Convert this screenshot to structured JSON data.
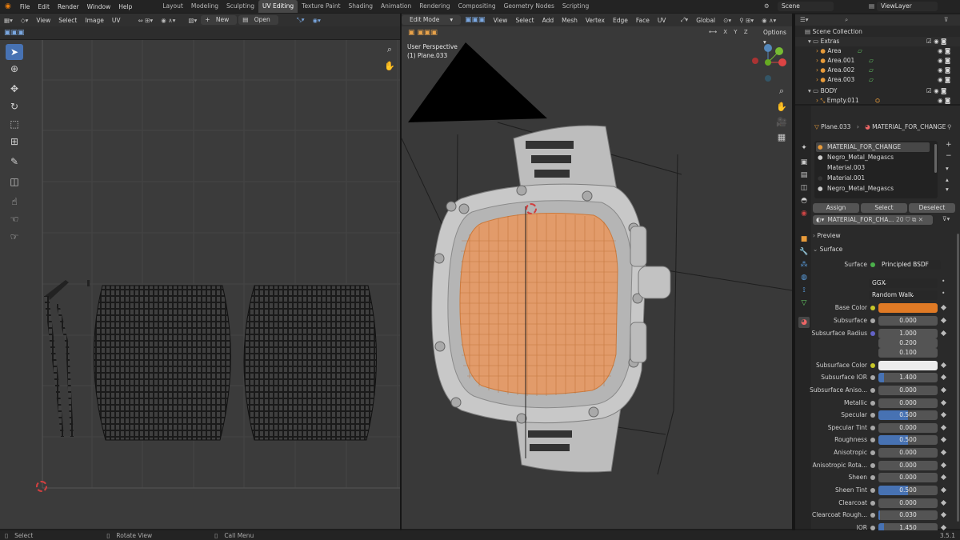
{
  "topbar": {
    "menu": [
      "File",
      "Edit",
      "Render",
      "Window",
      "Help"
    ],
    "tabs": [
      "Layout",
      "Modeling",
      "Sculpting",
      "UV Editing",
      "Texture Paint",
      "Shading",
      "Animation",
      "Rendering",
      "Compositing",
      "Geometry Nodes",
      "Scripting"
    ],
    "active_tab": "UV Editing",
    "scene": "Scene",
    "view_layer": "ViewLayer"
  },
  "uv_header": {
    "menus": [
      "View",
      "Select",
      "Image",
      "UV"
    ],
    "new_label": "New",
    "open_label": "Open"
  },
  "viewport_header": {
    "mode": "Edit Mode",
    "menus": [
      "View",
      "Select",
      "Add",
      "Mesh",
      "Vertex",
      "Edge",
      "Face",
      "UV"
    ],
    "orientation": "Global",
    "options_label": "Options",
    "axes": [
      "X",
      "Y",
      "Z"
    ]
  },
  "viewport": {
    "perspective": "User Perspective",
    "object": "(1) Plane.033"
  },
  "outliner": {
    "root": "Scene Collection",
    "rows": [
      {
        "name": "Extras",
        "level": 1
      },
      {
        "name": "Area",
        "level": 2
      },
      {
        "name": "Area.001",
        "level": 2
      },
      {
        "name": "Area.002",
        "level": 2
      },
      {
        "name": "Area.003",
        "level": 2
      },
      {
        "name": "BODY",
        "level": 1
      },
      {
        "name": "Empty.011",
        "level": 2
      }
    ]
  },
  "properties": {
    "breadcrumb_object": "Plane.033",
    "breadcrumb_material": "MATERIAL_FOR_CHANGE",
    "material_slots": [
      "MATERIAL_FOR_CHANGE",
      "Negro_Metal_Megascs",
      "Material.003",
      "Material.001",
      "Negro_Metal_Megascs"
    ],
    "active_slot": "MATERIAL_FOR_CHANGE",
    "assign_label": "Assign",
    "select_label": "Select",
    "deselect_label": "Deselect",
    "material_name": "MATERIAL_FOR_CHA...",
    "user_count": "20",
    "preview_label": "Preview",
    "surface_panel_label": "Surface",
    "surface_label": "Surface",
    "surface_shader": "Principled BSDF",
    "distribution": "GGX",
    "subsurface_method": "Random Walk",
    "base_color_label": "Base Color",
    "base_color": "#e07a25",
    "subsurface_color_label": "Subsurface Color",
    "subsurface_color": "#ececec",
    "subsurface_radius_label": "Subsurface Radius",
    "subsurface_radius": [
      "1.000",
      "0.200",
      "0.100"
    ],
    "params": [
      {
        "label": "Subsurface",
        "value": "0.000",
        "fill": 0
      },
      {
        "label": "Subsurface IOR",
        "value": "1.400",
        "fill": 0.1
      },
      {
        "label": "Subsurface Aniso...",
        "value": "0.000",
        "fill": 0
      },
      {
        "label": "Metallic",
        "value": "0.000",
        "fill": 0
      },
      {
        "label": "Specular",
        "value": "0.500",
        "fill": 0.5
      },
      {
        "label": "Specular Tint",
        "value": "0.000",
        "fill": 0
      },
      {
        "label": "Roughness",
        "value": "0.500",
        "fill": 0.5
      },
      {
        "label": "Anisotropic",
        "value": "0.000",
        "fill": 0
      },
      {
        "label": "Anisotropic Rota...",
        "value": "0.000",
        "fill": 0
      },
      {
        "label": "Sheen",
        "value": "0.000",
        "fill": 0
      },
      {
        "label": "Sheen Tint",
        "value": "0.500",
        "fill": 0.5
      },
      {
        "label": "Clearcoat",
        "value": "0.000",
        "fill": 0
      },
      {
        "label": "Clearcoat Rough...",
        "value": "0.030",
        "fill": 0.03
      },
      {
        "label": "IOR",
        "value": "1.450",
        "fill": 0.1
      }
    ]
  },
  "status": {
    "select": "Select",
    "rotate_view": "Rotate View",
    "call_menu": "Call Menu",
    "version": "3.5.1"
  },
  "colors": {
    "accent": "#4772b3",
    "face_orange": "#e29b6a"
  }
}
